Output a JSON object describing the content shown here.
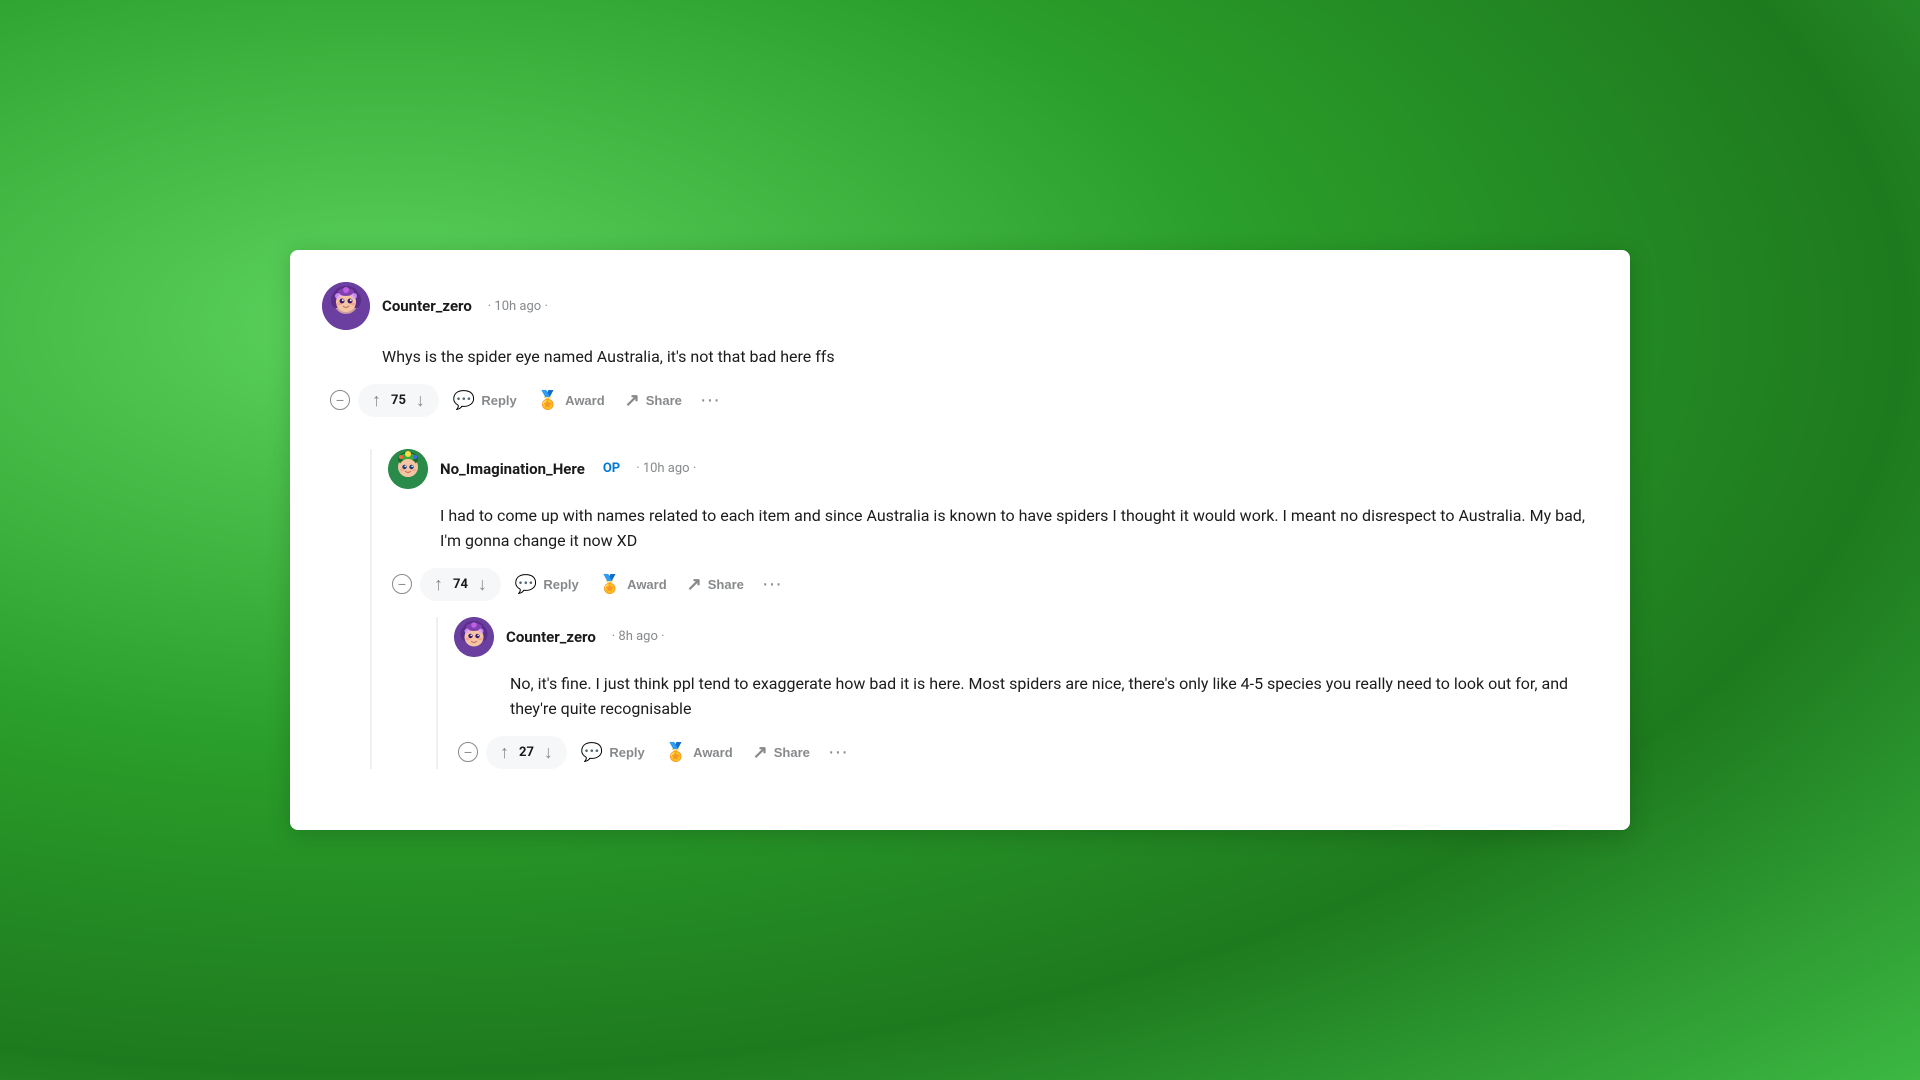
{
  "background": {
    "color": "#3cb843"
  },
  "comments": [
    {
      "id": "comment-1",
      "username": "Counter_zero",
      "timestamp": "10h ago",
      "body": "Whys is the spider eye named Australia, it's not that bad here ffs",
      "votes": "75",
      "actions": {
        "reply": "Reply",
        "award": "Award",
        "share": "Share",
        "more": "..."
      }
    },
    {
      "id": "comment-2",
      "username": "No_Imagination_Here",
      "op_badge": "OP",
      "timestamp": "10h ago",
      "body": "I had to come up with names related to each item and since Australia is known to have spiders I thought it would work. I meant no disrespect to Australia. My bad, I'm gonna change it now XD",
      "votes": "74",
      "actions": {
        "reply": "Reply",
        "award": "Award",
        "share": "Share",
        "more": "..."
      }
    },
    {
      "id": "comment-3",
      "username": "Counter_zero",
      "timestamp": "8h ago",
      "body": "No, it's fine. I just think ppl tend to exaggerate how bad it is here. Most spiders are nice, there's only like 4-5 species you really need to look out for, and they're quite recognisable",
      "votes": "27",
      "actions": {
        "reply": "Reply",
        "award": "Award",
        "share": "Share",
        "more": "..."
      }
    }
  ]
}
